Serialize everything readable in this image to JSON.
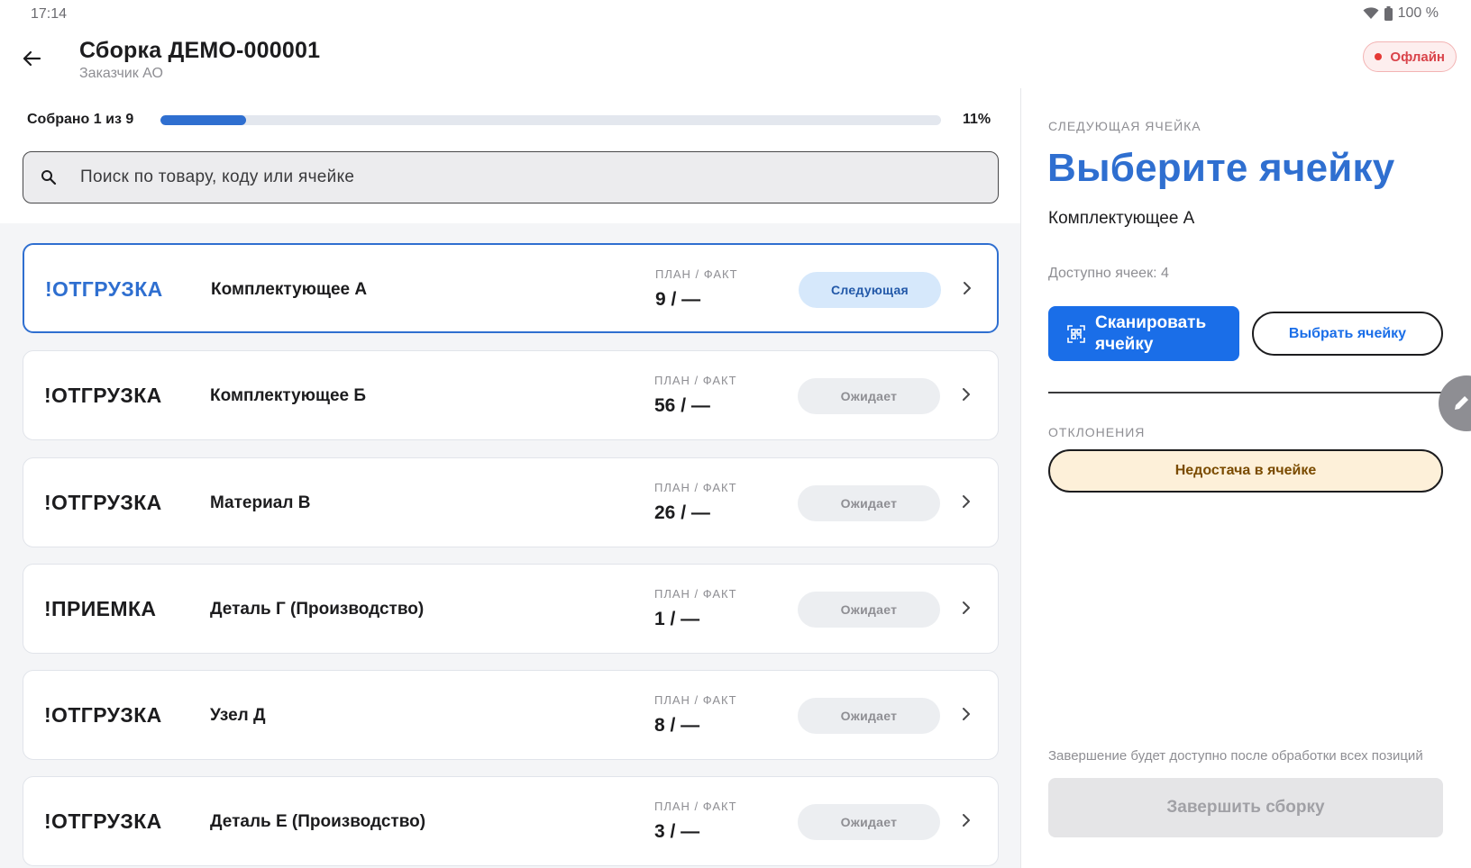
{
  "status_bar": {
    "time": "17:14",
    "battery": "100 %"
  },
  "header": {
    "title": "Сборка ДЕМО-000001",
    "subtitle": "Заказчик АО",
    "offline_label": "Офлайн"
  },
  "progress": {
    "label": "Собрано 1 из 9",
    "percent_text": "11%",
    "fraction": 0.11
  },
  "search": {
    "placeholder": "Поиск по товару, коду или ячейке"
  },
  "rows": [
    {
      "operation": "!ОТГРУЗКА",
      "name": "Комплектующее А",
      "plan_label": "ПЛАН / ФАКТ",
      "plan_fact": "9 / —",
      "status": "Следующая",
      "active": true
    },
    {
      "operation": "!ОТГРУЗКА",
      "name": "Комплектующее Б",
      "plan_label": "ПЛАН / ФАКТ",
      "plan_fact": "56 / —",
      "status": "Ожидает",
      "active": false
    },
    {
      "operation": "!ОТГРУЗКА",
      "name": "Материал В",
      "plan_label": "ПЛАН / ФАКТ",
      "plan_fact": "26 / —",
      "status": "Ожидает",
      "active": false
    },
    {
      "operation": "!ПРИЕМКА",
      "name": "Деталь Г (Производство)",
      "plan_label": "ПЛАН / ФАКТ",
      "plan_fact": "1 / —",
      "status": "Ожидает",
      "active": false
    },
    {
      "operation": "!ОТГРУЗКА",
      "name": "Узел Д",
      "plan_label": "ПЛАН / ФАКТ",
      "plan_fact": "8 / —",
      "status": "Ожидает",
      "active": false
    },
    {
      "operation": "!ОТГРУЗКА",
      "name": "Деталь Е (Производство)",
      "plan_label": "ПЛАН / ФАКТ",
      "plan_fact": "3 / —",
      "status": "Ожидает",
      "active": false
    }
  ],
  "right": {
    "next_cell_label": "СЛЕДУЮЩАЯ ЯЧЕЙКА",
    "title": "Выберите ячейку",
    "product": "Комплектующее А",
    "available": "Доступно ячеек: 4",
    "scan_button": "Сканировать ячейку",
    "choose_button": "Выбрать ячейку",
    "deviations_label": "ОТКЛОНЕНИЯ",
    "shortage_button": "Недостача в ячейке",
    "finish_hint": "Завершение будет доступно после обработки всех позиций",
    "finish_button": "Завершить сборку"
  },
  "icons": {
    "back": "arrow-left-icon",
    "search": "search-icon",
    "chevron": "chevron-right-icon",
    "scan": "qr-scan-icon",
    "edit": "pencil-icon",
    "wifi": "wifi-icon",
    "battery": "battery-icon"
  },
  "colors": {
    "accent": "#2f6fd0",
    "primary_button": "#1a6ee8",
    "offline": "#d9434a",
    "shortage_bg": "#fdf0d9"
  }
}
